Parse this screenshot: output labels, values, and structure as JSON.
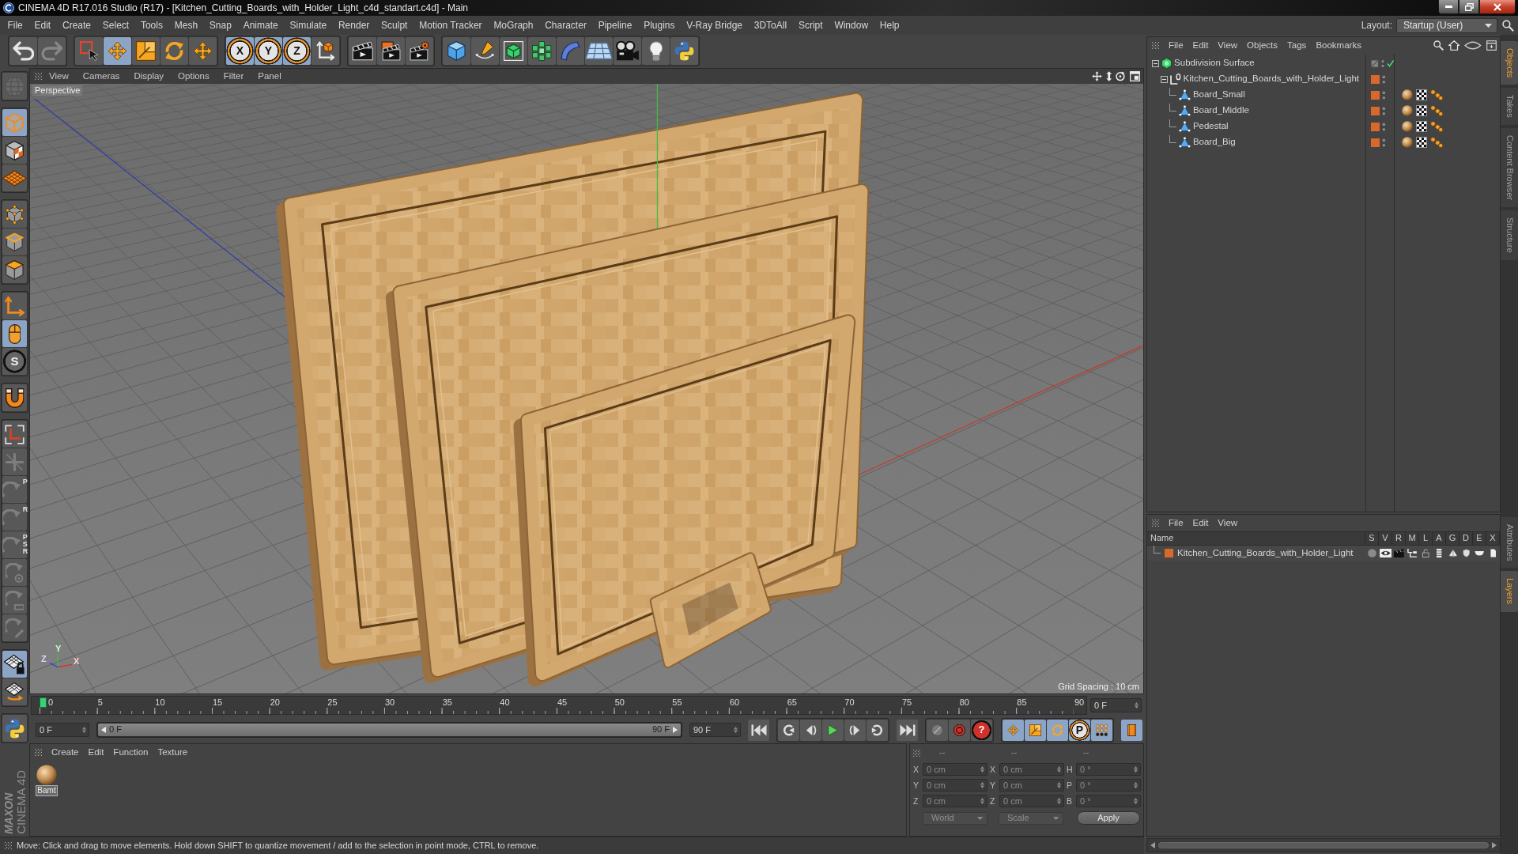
{
  "window": {
    "title": "CINEMA 4D R17.016 Studio (R17) - [Kitchen_Cutting_Boards_with_Holder_Light_c4d_standart.c4d] - Main"
  },
  "menu_bar": {
    "items": [
      "File",
      "Edit",
      "Create",
      "Select",
      "Tools",
      "Mesh",
      "Snap",
      "Animate",
      "Simulate",
      "Render",
      "Sculpt",
      "Motion Tracker",
      "MoGraph",
      "Character",
      "Pipeline",
      "Plugins",
      "V-Ray Bridge",
      "3DToAll",
      "Script",
      "Window",
      "Help"
    ],
    "layout_label": "Layout:",
    "layout": "Startup (User)"
  },
  "toolbar": {
    "groups": [
      [
        {
          "selected": false,
          "disabled": false
        },
        {
          "selected": false,
          "disabled": true
        }
      ],
      [
        {
          "selected": false,
          "disabled": false
        },
        {
          "selected": true,
          "disabled": false
        },
        {
          "selected": false,
          "disabled": false
        },
        {
          "selected": false,
          "disabled": false
        },
        {
          "selected": false,
          "disabled": false
        }
      ],
      [
        {
          "label": "X",
          "selected": true,
          "disabled": false
        },
        {
          "label": "Y",
          "selected": true,
          "disabled": false
        },
        {
          "label": "Z",
          "selected": true,
          "disabled": false
        },
        {
          "selected": false,
          "disabled": false
        }
      ],
      [
        {
          "selected": false,
          "disabled": false
        },
        {
          "selected": false,
          "disabled": false
        },
        {
          "selected": false,
          "disabled": false
        }
      ],
      [
        {
          "selected": false,
          "disabled": false
        },
        {
          "selected": false,
          "disabled": false
        },
        {
          "selected": false,
          "disabled": false
        },
        {
          "selected": false,
          "disabled": false
        },
        {
          "selected": false,
          "disabled": false
        },
        {
          "selected": false,
          "disabled": false
        },
        {
          "selected": false,
          "disabled": false
        },
        {
          "selected": false,
          "disabled": false
        },
        {
          "selected": false,
          "disabled": false
        }
      ]
    ]
  },
  "left_toolbar": {
    "groups": [
      [
        {
          "selected": false,
          "disabled": true
        }
      ],
      [
        {
          "selected": true,
          "disabled": false
        },
        {
          "selected": false,
          "disabled": false
        },
        {
          "selected": false,
          "disabled": false
        }
      ],
      [
        {
          "selected": false,
          "disabled": false
        },
        {
          "selected": false,
          "disabled": false
        },
        {
          "selected": false,
          "disabled": false
        }
      ],
      [
        {
          "selected": false,
          "disabled": false
        },
        {
          "selected": true,
          "disabled": false
        },
        {
          "label": "S",
          "selected": false,
          "disabled": false
        }
      ],
      [
        {
          "selected": false,
          "disabled": false
        }
      ],
      [
        {
          "selected": false,
          "disabled": false
        },
        {
          "selected": false,
          "disabled": true
        },
        {
          "label": "P",
          "selected": false,
          "disabled": true
        },
        {
          "label": "R",
          "selected": false,
          "disabled": true
        },
        {
          "label": "P S R",
          "selected": false,
          "disabled": true
        },
        {
          "selected": false,
          "disabled": true
        },
        {
          "selected": false,
          "disabled": true
        },
        {
          "selected": false,
          "disabled": true
        }
      ],
      [
        {
          "selected": true,
          "disabled": false
        },
        {
          "selected": false,
          "disabled": false
        }
      ],
      [
        {
          "selected": false,
          "disabled": false
        }
      ]
    ]
  },
  "viewport": {
    "menu": [
      "View",
      "Cameras",
      "Display",
      "Options",
      "Filter",
      "Panel"
    ],
    "camera": "Perspective",
    "grid_spacing": "Grid Spacing : 10 cm",
    "gizmo_labels": [
      "Y",
      "Z",
      "X"
    ]
  },
  "timeline": {
    "ticks": [
      "0",
      "5",
      "10",
      "15",
      "20",
      "25",
      "30",
      "35",
      "40",
      "45",
      "50",
      "55",
      "60",
      "65",
      "70",
      "75",
      "80",
      "85",
      "90"
    ],
    "level": 0,
    "frame": "0 F"
  },
  "playback": {
    "start": "0 F",
    "range": {
      "start": "0 F",
      "end": "90 F",
      "level": 1
    },
    "end": "90 F",
    "record_buttons": [
      {
        "kind": "autokey"
      },
      {
        "kind": "record"
      },
      {
        "kind": "help",
        "label": "?"
      }
    ],
    "key_toggles": [
      {
        "selected": true
      },
      {
        "selected": true
      },
      {
        "selected": true
      },
      {
        "label": "P",
        "selected": true
      },
      {
        "selected": true
      }
    ],
    "timeline_toggle": {
      "selected": true
    }
  },
  "materials": {
    "menu": [
      "Create",
      "Edit",
      "Function",
      "Texture"
    ],
    "items": [
      {
        "name": "Bamt",
        "selected": true
      }
    ]
  },
  "coordinates": {
    "headers": [
      "--",
      "--",
      "--"
    ],
    "rows": [
      {
        "position_axis": "X",
        "position": "0 cm",
        "size_axis": "X",
        "size": "0 cm",
        "rotation_axis": "H",
        "rotation": "0 °"
      },
      {
        "position_axis": "Y",
        "position": "0 cm",
        "size_axis": "Y",
        "size": "0 cm",
        "rotation_axis": "P",
        "rotation": "0 °"
      },
      {
        "position_axis": "Z",
        "position": "0 cm",
        "size_axis": "Z",
        "size": "0 cm",
        "rotation_axis": "B",
        "rotation": "0 °"
      }
    ],
    "space": "World",
    "mode": "Scale",
    "apply": "Apply"
  },
  "status_bar": {
    "text": "Move: Click and drag to move elements. Hold down SHIFT to quantize movement / add to the selection in point mode, CTRL to remove."
  },
  "object_manager": {
    "menu": [
      "File",
      "Edit",
      "View",
      "Objects",
      "Tags",
      "Bookmarks"
    ],
    "objects": [
      {
        "name": "Subdivision Surface",
        "kind": "generator",
        "enabled": true,
        "expanded": true,
        "children": [
          {
            "name": "Kitchen_Cutting_Boards_with_Holder_Light",
            "kind": "null",
            "color": "#d8692b",
            "expanded": true,
            "children": [
              {
                "name": "Board_Small",
                "kind": "polygon",
                "color": "#d8692b",
                "tags": [
                  {
                    "kind": "material"
                  },
                  {
                    "kind": "uvw"
                  },
                  {
                    "kind": "phong"
                  }
                ]
              },
              {
                "name": "Board_Middle",
                "kind": "polygon",
                "color": "#d8692b",
                "tags": [
                  {
                    "kind": "material"
                  },
                  {
                    "kind": "uvw"
                  },
                  {
                    "kind": "phong"
                  }
                ]
              },
              {
                "name": "Pedestal",
                "kind": "polygon",
                "color": "#d8692b",
                "tags": [
                  {
                    "kind": "material"
                  },
                  {
                    "kind": "uvw"
                  },
                  {
                    "kind": "phong"
                  }
                ]
              },
              {
                "name": "Board_Big",
                "kind": "polygon",
                "color": "#d8692b",
                "tags": [
                  {
                    "kind": "material"
                  },
                  {
                    "kind": "uvw"
                  },
                  {
                    "kind": "phong"
                  }
                ]
              }
            ]
          }
        ]
      }
    ]
  },
  "layer_manager": {
    "menu": [
      "File",
      "Edit",
      "View"
    ],
    "columns": [
      "Name",
      "S",
      "V",
      "R",
      "M",
      "L",
      "A",
      "G",
      "D",
      "E",
      "X"
    ],
    "layers": [
      {
        "name": "Kitchen_Cutting_Boards_with_Holder_Light",
        "color": "#d8692b",
        "solo": false,
        "visible": true,
        "render": true,
        "manager": true,
        "locked": false,
        "animation": true,
        "generators": true,
        "deformers": true,
        "expressions": true,
        "xref": true
      }
    ]
  },
  "side_tabs": {
    "top": [
      {
        "label": "Objects",
        "selected": true
      },
      {
        "label": "Takes",
        "selected": false
      },
      {
        "label": "Content Browser",
        "selected": false
      },
      {
        "label": "Structure",
        "selected": false
      }
    ],
    "bottom": [
      {
        "label": "Attributes",
        "selected": false
      },
      {
        "label": "Layers",
        "selected": true
      }
    ]
  },
  "logo": {
    "brand": "MAXON",
    "product": "CINEMA 4D"
  }
}
